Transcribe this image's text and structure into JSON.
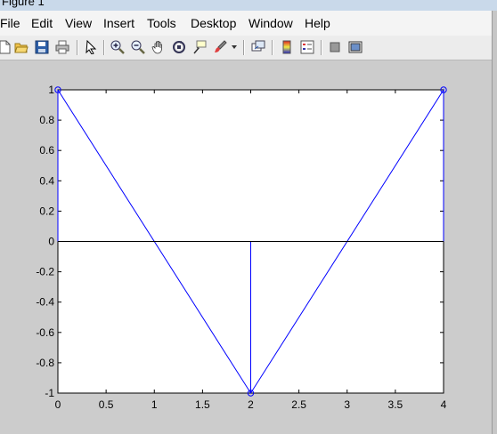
{
  "window": {
    "title": "Figure 1"
  },
  "menubar": {
    "items": [
      "File",
      "Edit",
      "View",
      "Insert",
      "Tools",
      "Desktop",
      "Window",
      "Help"
    ]
  },
  "toolbar": {
    "buttons": [
      {
        "name": "new-figure-icon"
      },
      {
        "name": "open-file-icon"
      },
      {
        "name": "save-icon"
      },
      {
        "name": "print-icon"
      },
      {
        "name": "edit-plot-arrow-icon"
      },
      {
        "name": "zoom-in-icon"
      },
      {
        "name": "zoom-out-icon"
      },
      {
        "name": "pan-hand-icon"
      },
      {
        "name": "rotate-3d-icon"
      },
      {
        "name": "data-cursor-icon"
      },
      {
        "name": "brush-icon"
      },
      {
        "name": "brush-dropdown-icon"
      },
      {
        "name": "link-plot-icon"
      },
      {
        "name": "insert-colorbar-icon"
      },
      {
        "name": "insert-legend-icon"
      },
      {
        "name": "hide-plot-tools-icon"
      },
      {
        "name": "show-plot-tools-icon"
      }
    ]
  },
  "chart_data": {
    "type": "line",
    "title": "",
    "xlabel": "",
    "ylabel": "",
    "xlim": [
      0,
      4
    ],
    "ylim": [
      -1,
      1
    ],
    "xticks": [
      0,
      0.5,
      1,
      1.5,
      2,
      2.5,
      3,
      3.5,
      4
    ],
    "xtick_labels": [
      "0",
      "0.5",
      "1",
      "1.5",
      "2",
      "2.5",
      "3",
      "3.5",
      "4"
    ],
    "yticks": [
      1,
      0.8,
      0.6,
      0.4,
      0.2,
      0,
      -0.2,
      -0.4,
      -0.6,
      -0.8,
      -1
    ],
    "ytick_labels": [
      "1",
      "0.8",
      "0.6",
      "0.4",
      "0.2",
      "0",
      "-0.2",
      "-0.4",
      "-0.6",
      "-0.8",
      "-1"
    ],
    "grid": false,
    "series": [
      {
        "style": "line",
        "color": "#0000ff",
        "x": [
          0,
          2,
          4,
          4
        ],
        "y": [
          1,
          -1,
          1,
          0
        ]
      },
      {
        "style": "line",
        "color": "#0000ff",
        "x": [
          0,
          0
        ],
        "y": [
          1,
          0
        ]
      },
      {
        "style": "stem",
        "color": "#0000ff",
        "marker": "circle",
        "x": [
          0,
          2,
          4
        ],
        "y": [
          1,
          -1,
          1
        ]
      },
      {
        "style": "baseline",
        "color": "#000000",
        "x": [
          0,
          4
        ],
        "y": [
          0,
          0
        ]
      }
    ]
  }
}
